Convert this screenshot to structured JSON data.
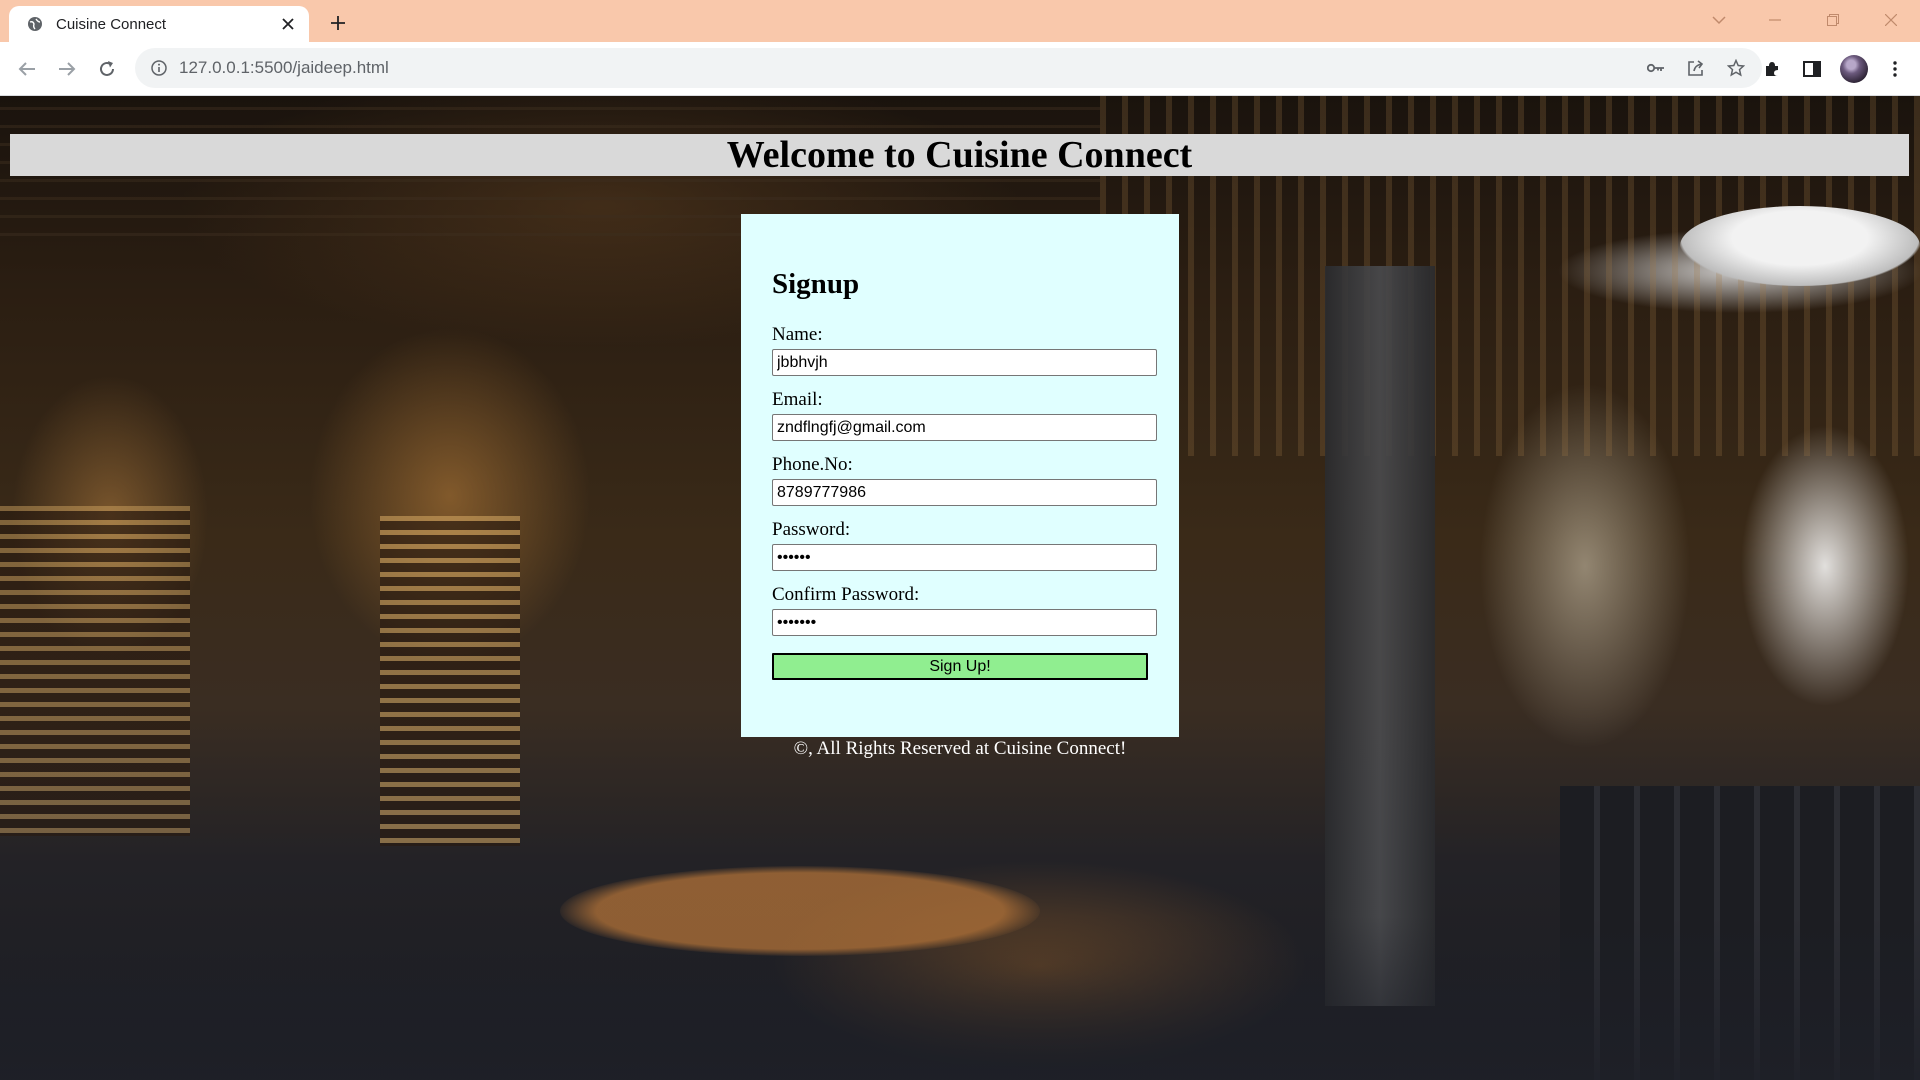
{
  "browser": {
    "tab_title": "Cuisine Connect",
    "url": "127.0.0.1:5500/jaideep.html"
  },
  "page": {
    "header_title": "Welcome to Cuisine Connect",
    "form": {
      "title": "Signup",
      "fields": [
        {
          "label": "Name:",
          "value": "jbbhvjh",
          "type": "text"
        },
        {
          "label": "Email:",
          "value": "zndflngfj@gmail.com",
          "type": "email"
        },
        {
          "label": "Phone.No:",
          "value": "8789777986",
          "type": "tel"
        },
        {
          "label": "Password:",
          "value": "123456",
          "type": "password"
        },
        {
          "label": "Confirm Password:",
          "value": "1234567",
          "type": "password"
        }
      ],
      "submit_label": "Sign Up!"
    },
    "footer": "©, All Rights Reserved at Cuisine Connect!"
  },
  "colors": {
    "tabbar_bg": "#f9c8ab",
    "header_bg": "#d9d9d9",
    "card_bg": "#e0ffff",
    "button_bg": "#90ee90"
  }
}
